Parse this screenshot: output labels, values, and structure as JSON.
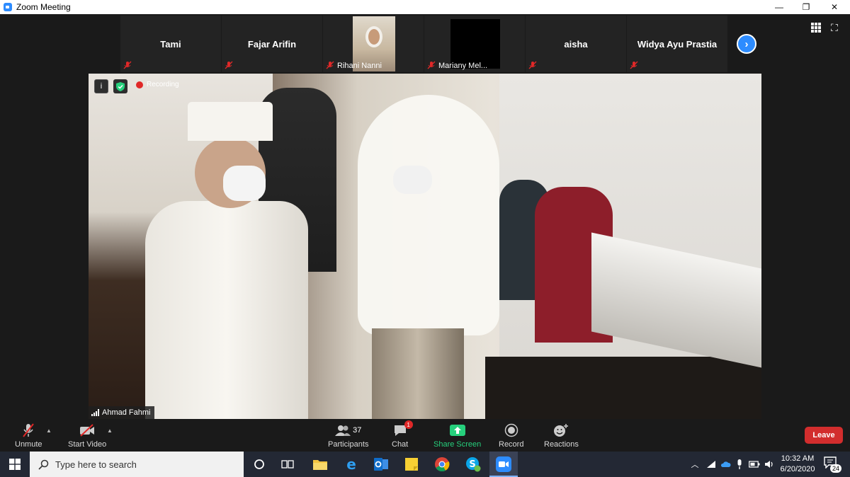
{
  "window": {
    "title": "Zoom Meeting",
    "minimize": "—",
    "restore": "❐",
    "close": "✕"
  },
  "thumbnails": [
    {
      "name": "Tami",
      "type": "name"
    },
    {
      "name": "Fajar Arifin",
      "type": "name"
    },
    {
      "name": "Rihani Nanni",
      "type": "video"
    },
    {
      "name": "Mariany Mel...",
      "type": "black"
    },
    {
      "name": "aisha",
      "type": "name"
    },
    {
      "name": "Widya Ayu Prastia",
      "type": "name"
    }
  ],
  "speaker": {
    "name": "Ahmad Fahmi",
    "recording_label": "Recording",
    "info": "i"
  },
  "toolbar": {
    "unmute": "Unmute",
    "start_video": "Start Video",
    "participants": "Participants",
    "participants_count": "37",
    "chat": "Chat",
    "chat_badge": "1",
    "share_screen": "Share Screen",
    "record": "Record",
    "reactions": "Reactions",
    "leave": "Leave"
  },
  "taskbar": {
    "search_placeholder": "Type here to search",
    "time": "10:32 AM",
    "date": "6/20/2020",
    "notification_count": "24"
  },
  "colors": {
    "zoom_blue": "#2d8cff",
    "leave_red": "#d22d2d",
    "share_green": "#26d07c",
    "muted_red": "#e02828"
  }
}
